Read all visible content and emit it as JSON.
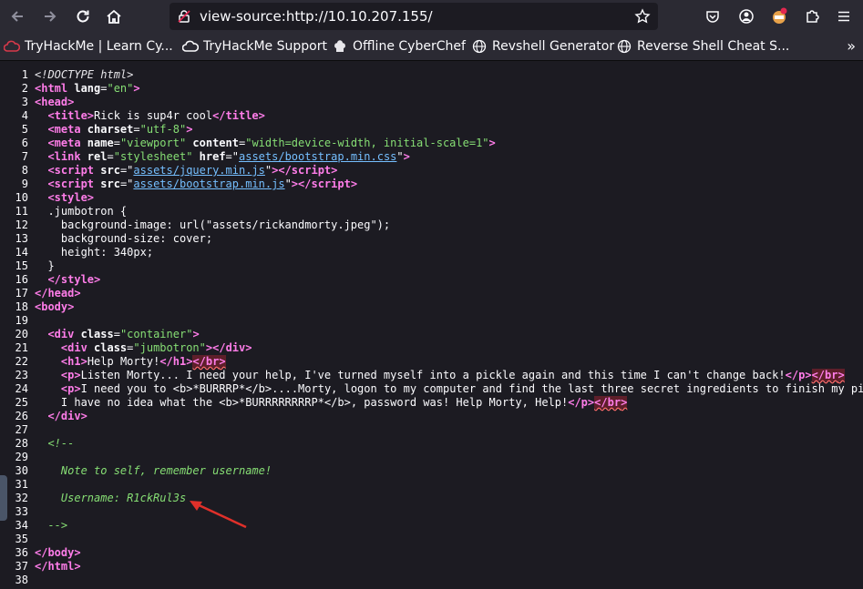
{
  "browser": {
    "url": "view-source:http://10.10.207.155/"
  },
  "bookmarks": [
    {
      "label": "TryHackMe | Learn Cy...",
      "icon": "tryhackme-cloud-icon"
    },
    {
      "label": "TryHackMe Support",
      "icon": "support-cloud-icon"
    },
    {
      "label": "Offline CyberChef",
      "icon": "chef-hat-icon"
    },
    {
      "label": "Revshell Generator",
      "icon": "globe-icon"
    },
    {
      "label": "Reverse Shell Cheat S...",
      "icon": "globe-icon"
    }
  ],
  "source": {
    "line_numbers": [
      "1",
      "2",
      "3",
      "4",
      "5",
      "6",
      "7",
      "8",
      "9",
      "10",
      "11",
      "12",
      "13",
      "14",
      "15",
      "16",
      "17",
      "18",
      "19",
      "20",
      "21",
      "22",
      "23",
      "24",
      "25",
      "26",
      "27",
      "28",
      "29",
      "30",
      "31",
      "32",
      "33",
      "34",
      "35",
      "36",
      "37",
      "38"
    ],
    "texts": {
      "l1": "<!DOCTYPE html>",
      "l2_tag": "<html",
      "l2_attr": " lang",
      "l2_eq": "=",
      "l2_val": "\"en\"",
      "l2_close": ">",
      "l3": "<head>",
      "l4_open": "<title>",
      "l4_text": "Rick is sup4r cool",
      "l4_close": "</title>",
      "l5_tag": "<meta",
      "l5_attr": " charset",
      "l5_val": "\"utf-8\"",
      "l6_tag": "<meta",
      "l6_attr1": " name",
      "l6_val1": "\"viewport\"",
      "l6_attr2": " content",
      "l6_val2": "\"width=device-width, initial-scale=1\"",
      "l7_tag": "<link",
      "l7_attr1": " rel",
      "l7_val1": "\"stylesheet\"",
      "l7_attr2": " href",
      "l7_link": "assets/bootstrap.min.css",
      "l8_tag": "<script",
      "l8_attr": " src",
      "l8_link": "assets/jquery.min.js",
      "l8_close": "</script",
      "l9_tag": "<script",
      "l9_attr": " src",
      "l9_link": "assets/bootstrap.min.js",
      "l9_close": "</script",
      "l10": "<style>",
      "l11": "  .jumbotron {",
      "l12": "    background-image: url(\"assets/rickandmorty.jpeg\");",
      "l13": "    background-size: cover;",
      "l14": "    height: 340px;",
      "l15": "  }",
      "l16": "</style>",
      "l17": "</head>",
      "l18": "<body>",
      "l20_tag": "<div",
      "l20_attr": " class",
      "l20_val": "\"container\"",
      "l21_tag": "<div",
      "l21_attr": " class",
      "l21_val": "\"jumbotron\"",
      "l21_close": "</div",
      "l22_open": "<h1",
      "l22_text": "Help Morty!",
      "l22_close": "</h1",
      "l22_err": "</br",
      "l23_open": "<p",
      "l23_text": "Listen Morty... I need your help, I've turned myself into a pickle again and this time I can't change back!",
      "l23_close": "</p",
      "l23_err": "</br",
      "l24_open": "<p",
      "l24_text1": "I need you to ",
      "l24_b": "<b>",
      "l24_btext": "*BURRRP*",
      "l24_bclose": "</b>",
      "l24_text2": "....Morty, logon to my computer and find the last three secret ingredients to finish my pickle-reverse potion. The only problem is,",
      "l25_text1": "I have no idea what the ",
      "l25_b": "<b>",
      "l25_btext": "*BURRRRRRRRP*",
      "l25_bclose": "</b>",
      "l25_text2": ", password was! Help Morty, Help!",
      "l25_close": "</p",
      "l25_err": "</br",
      "l26": "</div>",
      "l28": "<!--",
      "l30": "Note to self, remember username!",
      "l32": "Username: R1ckRul3s",
      "l34": "-->",
      "l36": "</body>",
      "l37": "</html>"
    }
  },
  "annotation": {
    "arrow_color": "#e0302a"
  }
}
